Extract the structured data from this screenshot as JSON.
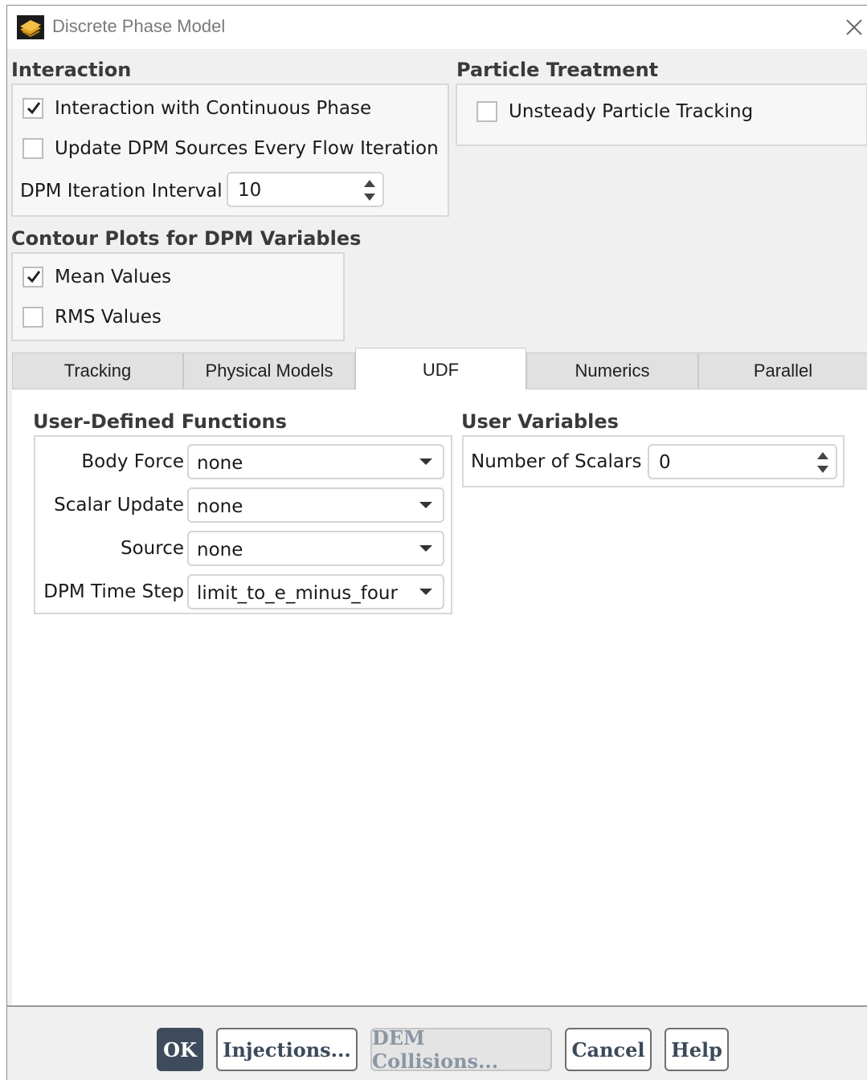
{
  "window": {
    "title": "Discrete Phase Model"
  },
  "interaction": {
    "title": "Interaction",
    "interaction_continuous": {
      "label": "Interaction with Continuous Phase",
      "checked": true
    },
    "update_dpm_sources": {
      "label": "Update DPM Sources Every Flow Iteration",
      "checked": false
    },
    "iteration_interval": {
      "label": "DPM Iteration Interval",
      "value": "10"
    }
  },
  "particle_treatment": {
    "title": "Particle Treatment",
    "unsteady_tracking": {
      "label": "Unsteady Particle Tracking",
      "checked": false
    }
  },
  "contour_plots": {
    "title": "Contour Plots for DPM Variables",
    "mean_values": {
      "label": "Mean Values",
      "checked": true
    },
    "rms_values": {
      "label": "RMS Values",
      "checked": false
    }
  },
  "tabs": [
    {
      "label": "Tracking",
      "active": false
    },
    {
      "label": "Physical Models",
      "active": false
    },
    {
      "label": "UDF",
      "active": true
    },
    {
      "label": "Numerics",
      "active": false
    },
    {
      "label": "Parallel",
      "active": false
    }
  ],
  "udf": {
    "title": "User-Defined Functions",
    "body_force": {
      "label": "Body Force",
      "value": "none"
    },
    "scalar_update": {
      "label": "Scalar Update",
      "value": "none"
    },
    "source": {
      "label": "Source",
      "value": "none"
    },
    "dpm_time_step": {
      "label": "DPM Time Step",
      "value": "limit_to_e_minus_four"
    }
  },
  "user_variables": {
    "title": "User Variables",
    "number_of_scalars": {
      "label": "Number of Scalars",
      "value": "0"
    }
  },
  "buttons": {
    "ok": "OK",
    "injections": "Injections...",
    "dem_collisions": "DEM Collisions...",
    "cancel": "Cancel",
    "help": "Help"
  },
  "colors": {
    "primary_button": "#3d4b5c",
    "group_border": "#d8d8d8",
    "panel_background": "#f0f0f0"
  },
  "icons": {
    "app": "fluent-app-icon",
    "close": "close-icon",
    "check": "checkmark-icon",
    "spinner": "spinner-arrows-icon",
    "dropdown": "chevron-down-icon"
  }
}
